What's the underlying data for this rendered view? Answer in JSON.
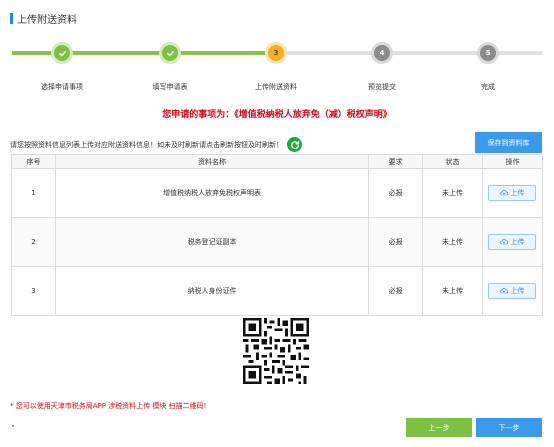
{
  "page": {
    "title": "上传附送资料"
  },
  "steps": [
    {
      "label": "选择申请事项",
      "number": "1",
      "state": "done"
    },
    {
      "label": "填写申请表",
      "number": "2",
      "state": "done"
    },
    {
      "label": "上传附送资料",
      "number": "3",
      "state": "current"
    },
    {
      "label": "预览提交",
      "number": "4",
      "state": "todo"
    },
    {
      "label": "完成",
      "number": "5",
      "state": "todo"
    }
  ],
  "matter": {
    "prefix": "您申请的事项为：",
    "name": "《增值税纳税人放弃免（减）税权声明》"
  },
  "instruction": "请您按照资料信息列表上传对应附送资料信息！如未及时刷新请点击刷新按钮及时刷新！",
  "save_button": "保存到资料库",
  "table": {
    "headers": {
      "seq": "序号",
      "name": "资料名称",
      "requirement": "要求",
      "status": "状态",
      "operation": "操作"
    },
    "rows": [
      {
        "seq": "1",
        "name": "增值税纳税人放弃免税权声明表",
        "requirement": "必报",
        "status": "未上传",
        "action": "上传"
      },
      {
        "seq": "2",
        "name": "税务登记证副本",
        "requirement": "必报",
        "status": "未上传",
        "action": "上传"
      },
      {
        "seq": "3",
        "name": "纳税人身份证件",
        "requirement": "必报",
        "status": "未上传",
        "action": "上传"
      }
    ]
  },
  "app_hint": "* 您可以使用天津市税务局APP 涉税资料上传 模块 扫描二维码!",
  "buttons": {
    "prev": "上一步",
    "next": "下一步"
  },
  "colors": {
    "accent_blue": "#3a9bee",
    "done_green": "#7cc142",
    "current_orange": "#f2b01e",
    "alert_red": "#e60012"
  },
  "icons": {
    "check": "check-icon",
    "refresh": "refresh-icon",
    "upload": "cloud-upload-icon"
  }
}
